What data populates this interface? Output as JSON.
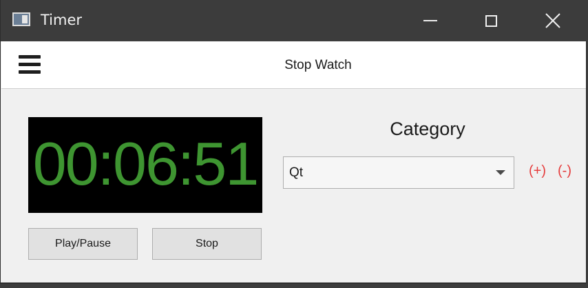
{
  "window": {
    "title": "Timer",
    "controls": {
      "minimize_icon": "minimize-icon",
      "maximize_icon": "maximize-icon",
      "close_icon": "close-icon"
    }
  },
  "toolbar": {
    "menu_icon": "hamburger-menu-icon",
    "title": "Stop Watch"
  },
  "stopwatch": {
    "display": "00:06:51",
    "play_pause_label": "Play/Pause",
    "stop_label": "Stop"
  },
  "category": {
    "label": "Category",
    "selected": "Qt",
    "add_label": "(+)",
    "remove_label": "(-)"
  },
  "colors": {
    "lcd_digits": "#3e9531",
    "lcd_background": "#000000",
    "link_red": "#e53c3c",
    "titlebar": "#3c3c3c"
  }
}
